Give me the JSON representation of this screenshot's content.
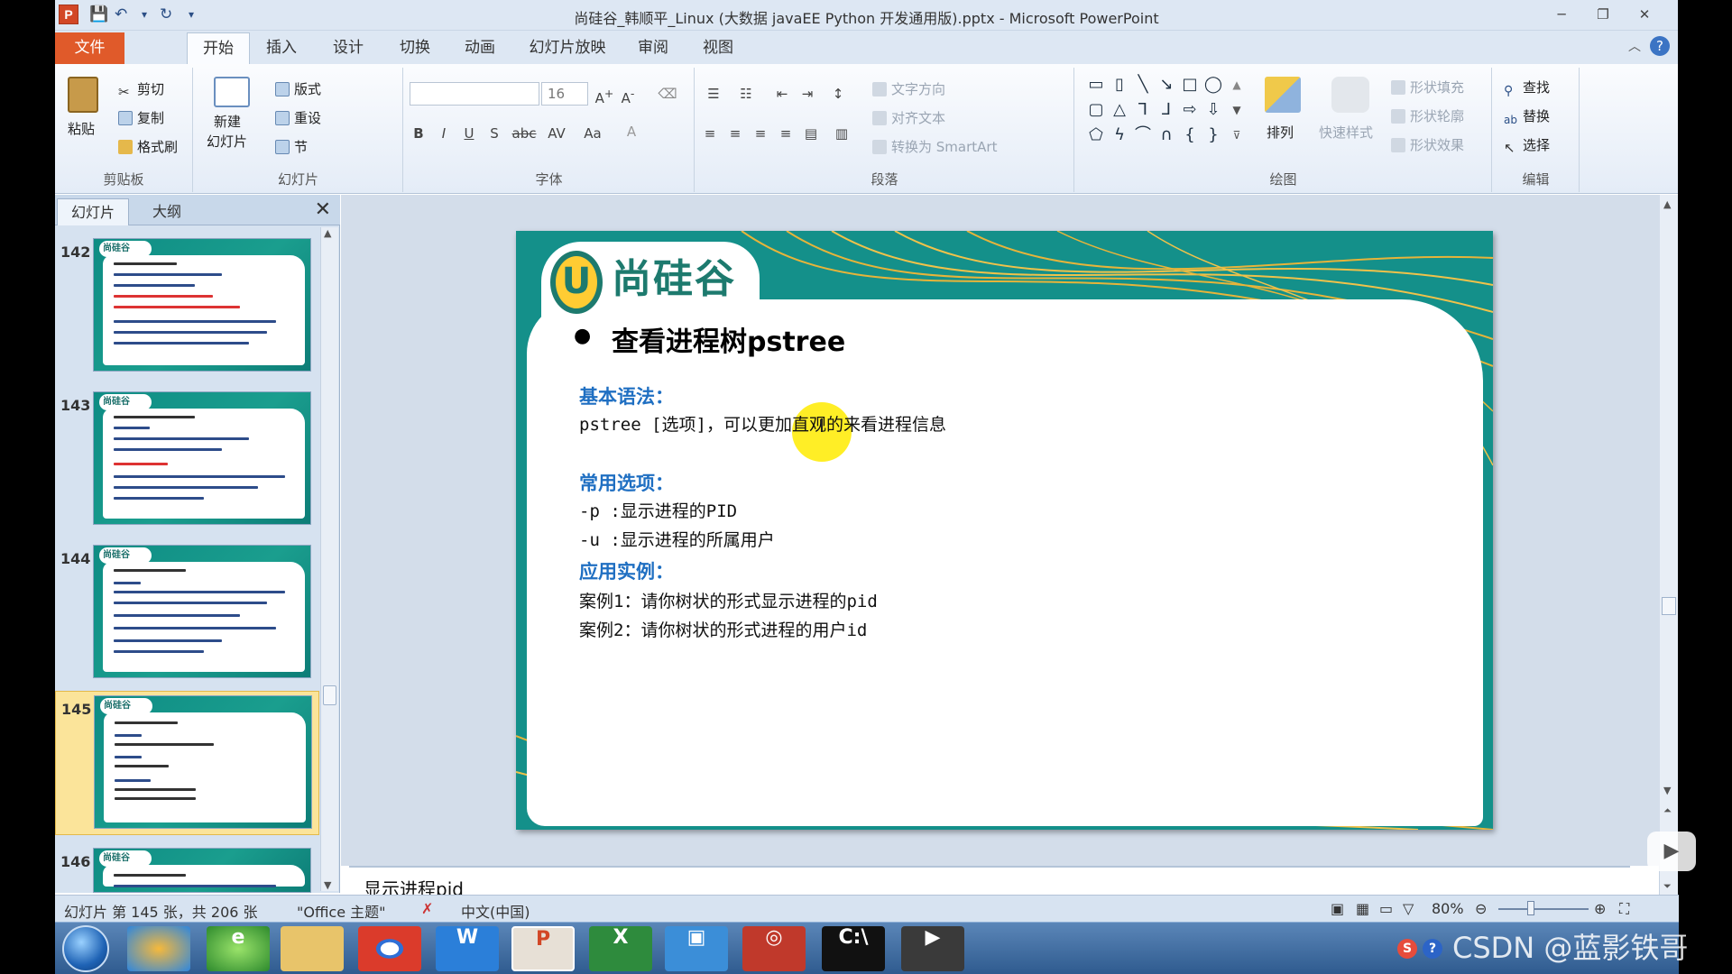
{
  "window": {
    "title": "尚硅谷_韩顺平_Linux (大数据 javaEE Python 开发通用版).pptx - Microsoft PowerPoint",
    "app_icon": "P",
    "controls": {
      "minimize": "─",
      "restore": "❐",
      "close": "✕"
    }
  },
  "tabs": [
    {
      "label": "文件"
    },
    {
      "label": "开始"
    },
    {
      "label": "插入"
    },
    {
      "label": "设计"
    },
    {
      "label": "切换"
    },
    {
      "label": "动画"
    },
    {
      "label": "幻灯片放映"
    },
    {
      "label": "审阅"
    },
    {
      "label": "视图"
    }
  ],
  "ribbon": {
    "clipboard": {
      "paste": "粘贴",
      "cut": "剪切",
      "copy": "复制",
      "format_painter": "格式刷",
      "label": "剪贴板"
    },
    "slides": {
      "new_slide_1": "新建",
      "new_slide_2": "幻灯片",
      "layout": "版式",
      "reset": "重设",
      "section": "节",
      "label": "幻灯片"
    },
    "font": {
      "name": "",
      "size": "16",
      "label": "字体"
    },
    "paragraph": {
      "text_direction": "文字方向",
      "align_text": "对齐文本",
      "smartart": "转换为 SmartArt",
      "label": "段落"
    },
    "drawing": {
      "arrange": "排列",
      "quick_styles": "快速样式",
      "shape_fill": "形状填充",
      "shape_outline": "形状轮廓",
      "shape_effects": "形状效果",
      "label": "绘图"
    },
    "editing": {
      "find": "查找",
      "replace": "替换",
      "select": "选择",
      "label": "编辑"
    }
  },
  "left_pane": {
    "tabs": [
      "幻灯片",
      "大纲"
    ],
    "slides": [
      {
        "number": "142",
        "logo": "尚硅谷"
      },
      {
        "number": "143",
        "logo": "尚硅谷"
      },
      {
        "number": "144",
        "logo": "尚硅谷"
      },
      {
        "number": "145",
        "logo": "尚硅谷",
        "selected": true
      },
      {
        "number": "146",
        "logo": "尚硅谷"
      }
    ]
  },
  "slide": {
    "logo_letter": "U",
    "logo_text": "尚硅谷",
    "heading": "查看进程树pstree",
    "syntax_title": "基本语法：",
    "syntax_line": "pstree [选项]，可以更加直观的来看进程信息",
    "options_title": "常用选项：",
    "option_p": "-p :显示进程的PID",
    "option_u": "-u :显示进程的所属用户",
    "examples_title": "应用实例：",
    "example_1": "案例1：请你树状的形式显示进程的pid",
    "example_2": "案例2：请你树状的形式进程的用户id"
  },
  "notes": "显示进程pid",
  "status": {
    "slide_counter": "幻灯片 第 145 张，共 206 张",
    "theme": "\"Office 主题\"",
    "language": "中文(中国)",
    "zoom": "80%"
  },
  "taskbar": {
    "watermark": "CSDN @蓝影铁哥"
  },
  "colors": {
    "accent_teal": "#14908a",
    "heading_blue": "#1f6fc2",
    "file_tab": "#e05a2a",
    "selection_yellow": "#fbe49a"
  }
}
